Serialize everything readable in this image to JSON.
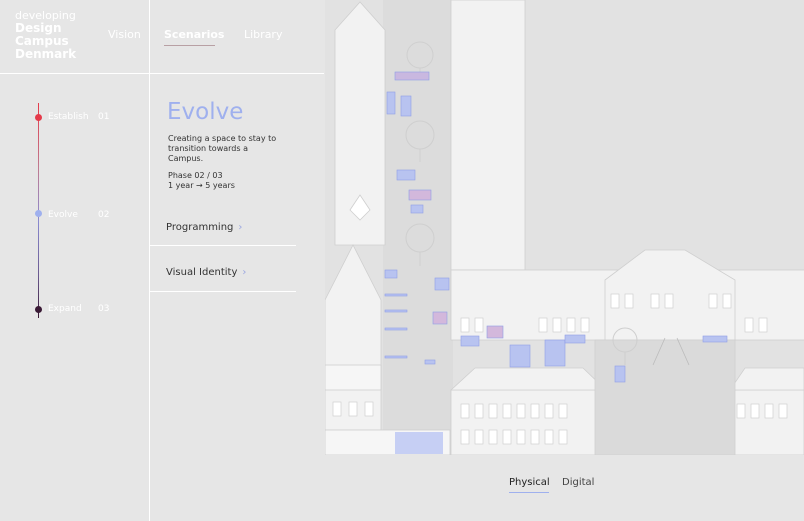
{
  "logo": {
    "line1": "developing",
    "line2": "Design",
    "line3": "Campus",
    "line4": "Denmark"
  },
  "nav": {
    "items": [
      "Vision",
      "Scenarios",
      "Library"
    ],
    "active": "Scenarios"
  },
  "timeline": {
    "phases": [
      {
        "label": "Establish",
        "num": "01",
        "color": "#e53a4a"
      },
      {
        "label": "Evolve",
        "num": "02",
        "color": "#9fb0ee"
      },
      {
        "label": "Expand",
        "num": "03",
        "color": "#3a1a35"
      }
    ]
  },
  "phase": {
    "title": "Evolve",
    "description": "Creating a space to stay to transition towards a Campus.",
    "counter": "Phase 02 / 03",
    "duration": "1 year → 5 years"
  },
  "menu": {
    "programming": "Programming",
    "visual_identity": "Visual Identity"
  },
  "tabs": {
    "physical": "Physical",
    "digital": "Digital",
    "active": "Physical"
  },
  "colors": {
    "accent": "#9fb0ee",
    "establish": "#e53a4a",
    "expand": "#3a1a35"
  }
}
